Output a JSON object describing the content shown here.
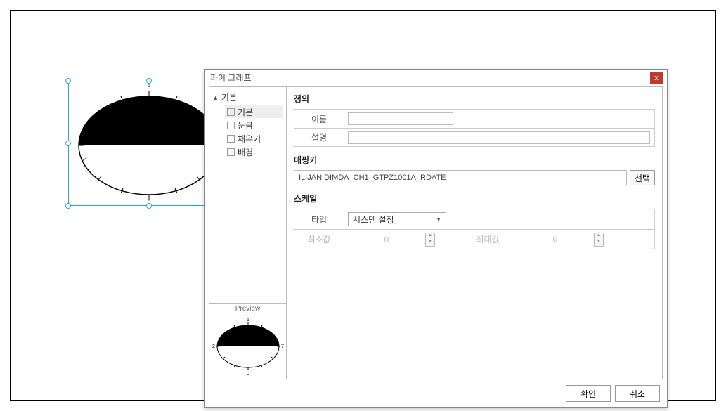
{
  "dialog": {
    "title": "파이 그래프",
    "close_glyph": "x"
  },
  "tree": {
    "root_label": "기본",
    "items": [
      {
        "label": "기본",
        "selected": true
      },
      {
        "label": "눈금",
        "selected": false
      },
      {
        "label": "채우기",
        "selected": false
      },
      {
        "label": "배경",
        "selected": false
      }
    ]
  },
  "preview": {
    "label": "Preview"
  },
  "panels": {
    "def": {
      "title": "정의",
      "name_label": "이름",
      "name_value": "",
      "desc_label": "설명",
      "desc_value": ""
    },
    "mapkey": {
      "title": "매핑키",
      "value": "ILIJAN.DIMDA_CH1_GTPZ1001A_RDATE",
      "select_btn": "선택"
    },
    "scale": {
      "title": "스케일",
      "type_label": "타입",
      "type_value": "시스템 설정",
      "min_label": "최소값",
      "min_value": "0",
      "max_label": "최대값",
      "max_value": "0"
    }
  },
  "gauge": {
    "top_label": "5",
    "bottom_label": "0"
  },
  "buttons": {
    "ok": "확인",
    "cancel": "취소"
  }
}
